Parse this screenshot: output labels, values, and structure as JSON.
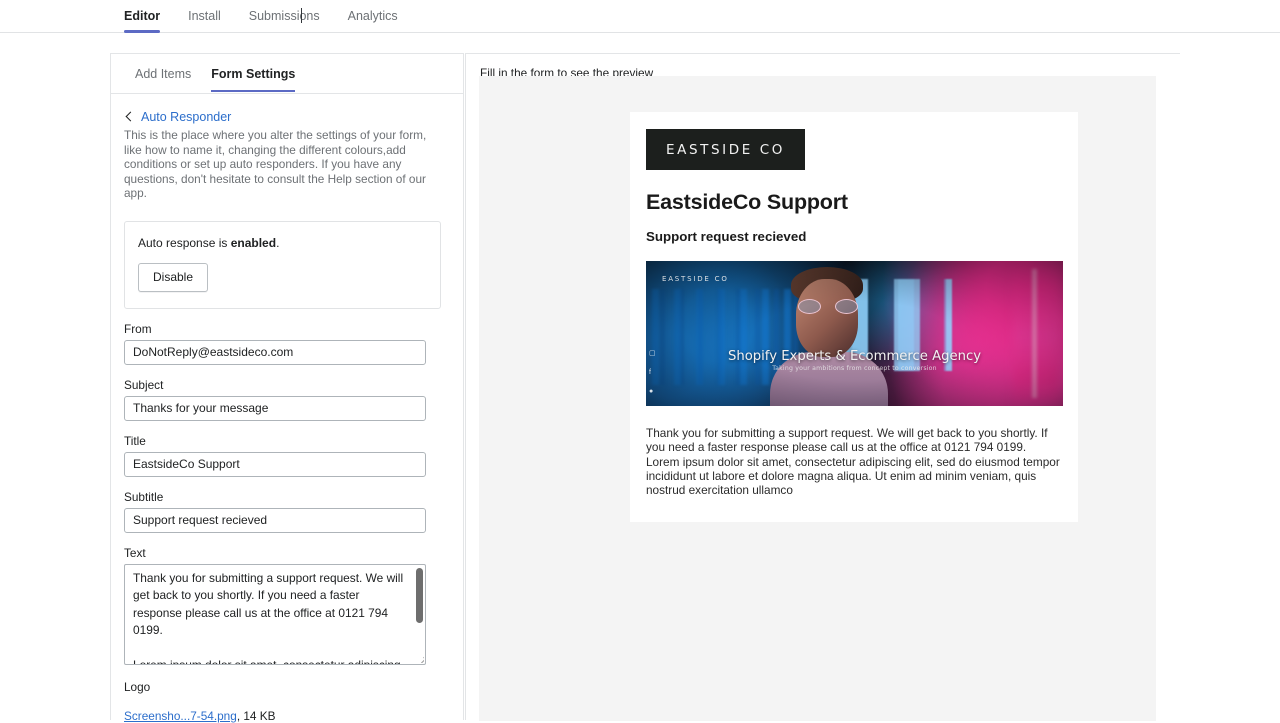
{
  "top_tabs": [
    {
      "label": "Editor",
      "active": true
    },
    {
      "label": "Install",
      "active": false
    },
    {
      "label": "Submissions",
      "active": false
    },
    {
      "label": "Analytics",
      "active": false
    }
  ],
  "sub_tabs": [
    {
      "label": "Add Items",
      "active": false
    },
    {
      "label": "Form Settings",
      "active": true
    }
  ],
  "settings": {
    "back_link": "Auto Responder",
    "description": "This is the place where you alter the settings of your form, like how to name it, changing the different colours,add conditions or set up auto responders. If you have any questions, don't hesitate to consult the Help section of our app.",
    "status_card": {
      "prefix": "Auto response is ",
      "state": "enabled",
      "suffix": ".",
      "button_label": "Disable"
    },
    "fields": [
      {
        "label": "From",
        "value": "DoNotReply@eastsideco.com",
        "placeholder": ""
      },
      {
        "label": "Subject",
        "value": "Thanks for your message",
        "placeholder": ""
      },
      {
        "label": "Title",
        "value": "EastsideCo Support",
        "placeholder": ""
      },
      {
        "label": "Subtitle",
        "value": "Support request recieved",
        "placeholder": ""
      }
    ],
    "text_field": {
      "label": "Text",
      "paragraph_1": "Thank you for submitting a support request. We will get back to you shortly. If you need a faster response please call us at the office at 0121 794 0199.",
      "paragraph_2": "Lorem ipsum dolor sit amet, consectetur adipiscing elit, sed do eiusmod tempor incididunt ut labore et dolore"
    },
    "logo": {
      "label": "Logo",
      "file_name": "Screensho...7-54.png",
      "file_size": ", 14 KB"
    }
  },
  "preview": {
    "caption": "Fill in the form to see the preview",
    "email": {
      "brand_logo_text": "EASTSIDE CO",
      "title": "EastsideCo Support",
      "subtitle": "Support request recieved",
      "banner": {
        "logo_text": "EASTSIDE CO",
        "headline": "Shopify Experts & Ecommerce Agency",
        "tagline": "Taking your ambitions from concept to conversion"
      },
      "body": "Thank you for submitting a support request. We will get back to you shortly. If you need a faster response please call us at the office at 0121 794 0199. Lorem ipsum dolor sit amet, consectetur adipiscing elit, sed do eiusmod tempor incididunt ut labore et dolore magna aliqua. Ut enim ad minim veniam, quis nostrud exercitation ullamco"
    }
  },
  "colors": {
    "accent": "#5c6ac4",
    "link": "#2c6ecb",
    "brand_dark": "#1c1f1d",
    "spellcheck": "#e02020"
  }
}
